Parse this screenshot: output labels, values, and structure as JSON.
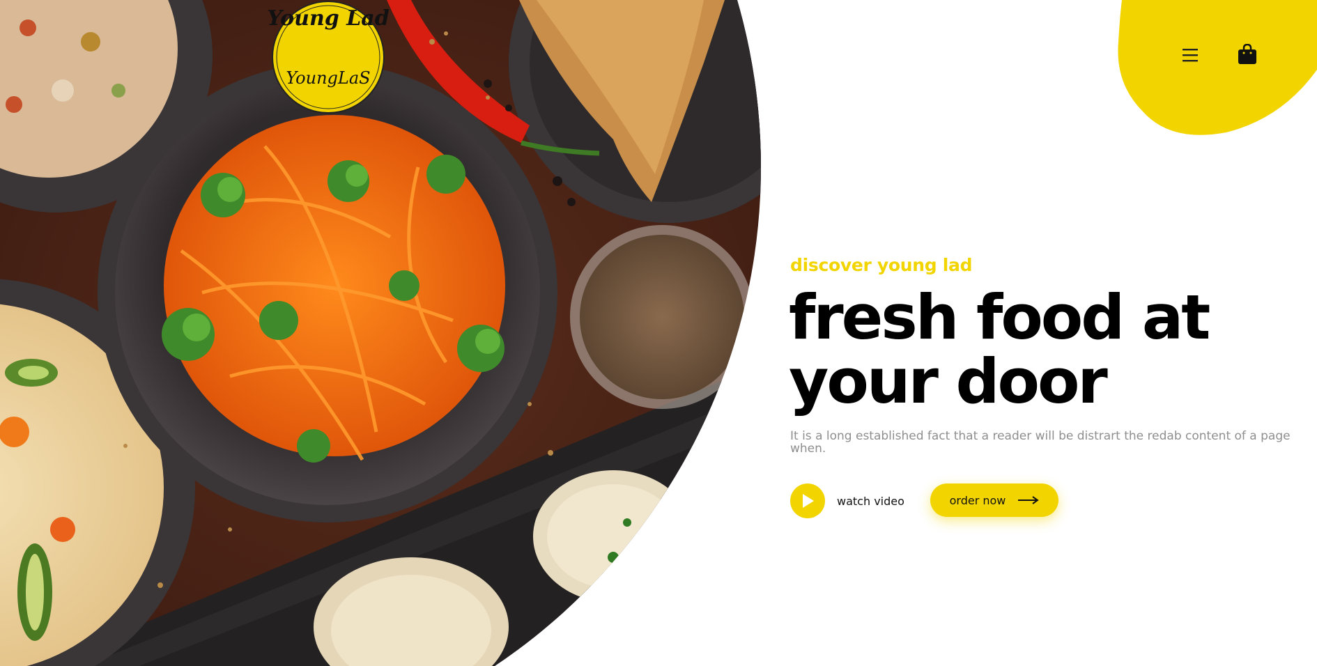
{
  "brand": {
    "logo_alt": "Young Lad",
    "logo_text_top": "Young Lad",
    "logo_text_script": "YoungLaS"
  },
  "header": {
    "menu_icon": "hamburger-menu-icon",
    "cart_icon": "shopping-bag-icon"
  },
  "hero": {
    "tagline": "discover young lad",
    "headline_line1": "fresh food at",
    "headline_line2": "your door",
    "description": "It is a long established fact that a reader will be distrart the redab content of a page when.",
    "watch_label": "watch video",
    "order_label": "order now"
  },
  "colors": {
    "accent": "#f2d500",
    "headline": "#000000",
    "muted": "#8e8e8e",
    "background": "#ffffff"
  }
}
